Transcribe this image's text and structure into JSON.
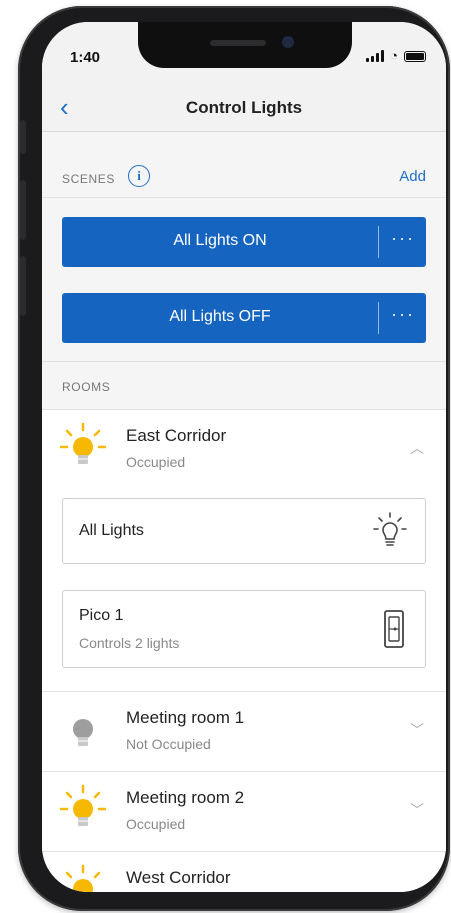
{
  "status_bar": {
    "time": "1:40",
    "signal_icon": "signal-icon",
    "wifi_icon": "wifi-icon",
    "battery_icon": "battery-icon"
  },
  "nav": {
    "back_icon": "chevron-left-icon",
    "back_glyph": "‹",
    "title": "Control Lights"
  },
  "scenes": {
    "label": "SCENES",
    "info_glyph": "i",
    "add_label": "Add",
    "items": [
      {
        "label": "All Lights ON",
        "more": "···"
      },
      {
        "label": "All Lights OFF",
        "more": "···"
      }
    ]
  },
  "rooms": {
    "label": "ROOMS",
    "expanded": {
      "name": "East Corridor",
      "status": "Occupied",
      "chevron": "︿",
      "cards": [
        {
          "title": "All Lights",
          "subtitle": "",
          "icon": "light-bulb-outline-icon"
        },
        {
          "title": "Pico 1",
          "subtitle": "Controls 2 lights",
          "icon": "pico-remote-icon"
        }
      ]
    },
    "items": [
      {
        "name": "Meeting room 1",
        "status": "Not Occupied",
        "chevron": "﹀",
        "lit": false
      },
      {
        "name": "Meeting room 2",
        "status": "Occupied",
        "chevron": "﹀",
        "lit": true
      },
      {
        "name": "West Corridor",
        "status": "",
        "chevron": "",
        "lit": true
      }
    ]
  },
  "colors": {
    "accent": "#1565c0",
    "bulb_on": "#f6b800",
    "bulb_off": "#9e9e9e"
  }
}
